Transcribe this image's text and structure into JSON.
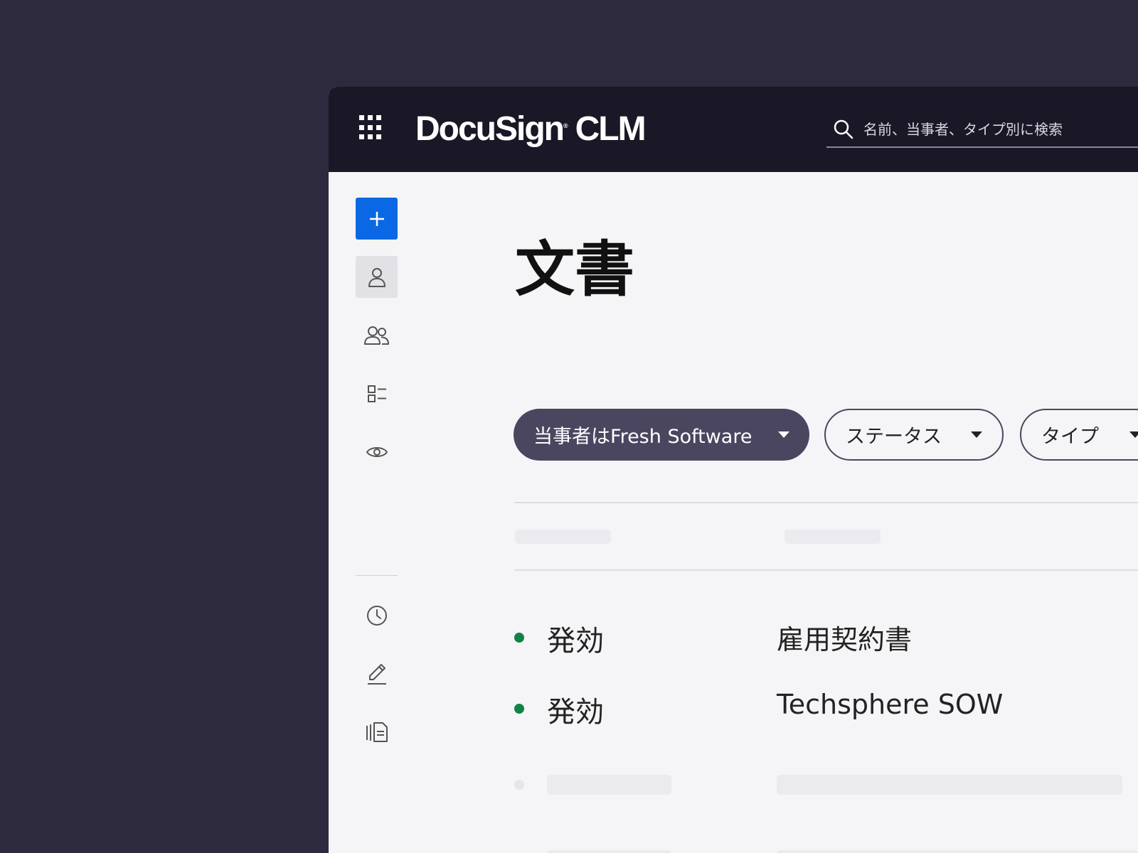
{
  "header": {
    "logo_text": "DocuSign",
    "logo_reg": "®",
    "logo_product": "CLM",
    "search_placeholder": "名前、当事者、タイプ別に検索"
  },
  "sidebar": {
    "items": [
      {
        "icon": "plus-icon"
      },
      {
        "icon": "person-icon"
      },
      {
        "icon": "people-icon"
      },
      {
        "icon": "list-icon"
      },
      {
        "icon": "eye-icon"
      },
      {
        "icon": "clock-icon"
      },
      {
        "icon": "pen-icon"
      },
      {
        "icon": "documents-icon"
      }
    ]
  },
  "main": {
    "title": "文書",
    "filters": [
      {
        "label": "当事者はFresh Software"
      },
      {
        "label": "ステータス"
      },
      {
        "label": "タイプ"
      }
    ],
    "rows": [
      {
        "status": "発効",
        "name": "雇用契約書"
      },
      {
        "status": "発効",
        "name": "Techsphere SOW"
      }
    ]
  },
  "colors": {
    "background": "#2d2a3d",
    "topbar": "#1a1826",
    "primary": "#0b68e4",
    "chip_filled": "#4a4660",
    "status_green": "#118346"
  }
}
